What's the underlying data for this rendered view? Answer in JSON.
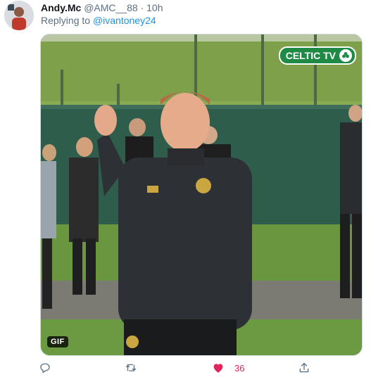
{
  "tweet": {
    "author_name": "Andy.Mc",
    "author_handle": "@AMC__88",
    "separator": "·",
    "time": "10h",
    "replying_prefix": "Replying to",
    "replying_handle": "@ivantoney24"
  },
  "media": {
    "badge": "GIF",
    "watermark": "CELTIC TV"
  },
  "actions": {
    "reply_icon": "reply-icon",
    "retweet_icon": "retweet-icon",
    "like_icon": "heart-icon",
    "like_count": "36",
    "like_color": "#e0245e",
    "share_icon": "share-icon"
  },
  "colors": {
    "link": "#1b95e0",
    "muted": "#5b7083"
  }
}
